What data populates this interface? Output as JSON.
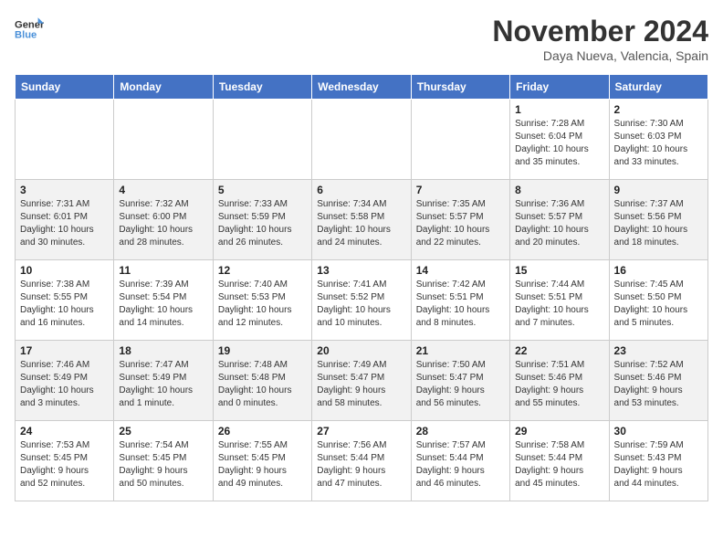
{
  "header": {
    "logo_line1": "General",
    "logo_line2": "Blue",
    "month_title": "November 2024",
    "location": "Daya Nueva, Valencia, Spain"
  },
  "weekdays": [
    "Sunday",
    "Monday",
    "Tuesday",
    "Wednesday",
    "Thursday",
    "Friday",
    "Saturday"
  ],
  "weeks": [
    [
      {
        "day": "",
        "info": ""
      },
      {
        "day": "",
        "info": ""
      },
      {
        "day": "",
        "info": ""
      },
      {
        "day": "",
        "info": ""
      },
      {
        "day": "",
        "info": ""
      },
      {
        "day": "1",
        "info": "Sunrise: 7:28 AM\nSunset: 6:04 PM\nDaylight: 10 hours\nand 35 minutes."
      },
      {
        "day": "2",
        "info": "Sunrise: 7:30 AM\nSunset: 6:03 PM\nDaylight: 10 hours\nand 33 minutes."
      }
    ],
    [
      {
        "day": "3",
        "info": "Sunrise: 7:31 AM\nSunset: 6:01 PM\nDaylight: 10 hours\nand 30 minutes."
      },
      {
        "day": "4",
        "info": "Sunrise: 7:32 AM\nSunset: 6:00 PM\nDaylight: 10 hours\nand 28 minutes."
      },
      {
        "day": "5",
        "info": "Sunrise: 7:33 AM\nSunset: 5:59 PM\nDaylight: 10 hours\nand 26 minutes."
      },
      {
        "day": "6",
        "info": "Sunrise: 7:34 AM\nSunset: 5:58 PM\nDaylight: 10 hours\nand 24 minutes."
      },
      {
        "day": "7",
        "info": "Sunrise: 7:35 AM\nSunset: 5:57 PM\nDaylight: 10 hours\nand 22 minutes."
      },
      {
        "day": "8",
        "info": "Sunrise: 7:36 AM\nSunset: 5:57 PM\nDaylight: 10 hours\nand 20 minutes."
      },
      {
        "day": "9",
        "info": "Sunrise: 7:37 AM\nSunset: 5:56 PM\nDaylight: 10 hours\nand 18 minutes."
      }
    ],
    [
      {
        "day": "10",
        "info": "Sunrise: 7:38 AM\nSunset: 5:55 PM\nDaylight: 10 hours\nand 16 minutes."
      },
      {
        "day": "11",
        "info": "Sunrise: 7:39 AM\nSunset: 5:54 PM\nDaylight: 10 hours\nand 14 minutes."
      },
      {
        "day": "12",
        "info": "Sunrise: 7:40 AM\nSunset: 5:53 PM\nDaylight: 10 hours\nand 12 minutes."
      },
      {
        "day": "13",
        "info": "Sunrise: 7:41 AM\nSunset: 5:52 PM\nDaylight: 10 hours\nand 10 minutes."
      },
      {
        "day": "14",
        "info": "Sunrise: 7:42 AM\nSunset: 5:51 PM\nDaylight: 10 hours\nand 8 minutes."
      },
      {
        "day": "15",
        "info": "Sunrise: 7:44 AM\nSunset: 5:51 PM\nDaylight: 10 hours\nand 7 minutes."
      },
      {
        "day": "16",
        "info": "Sunrise: 7:45 AM\nSunset: 5:50 PM\nDaylight: 10 hours\nand 5 minutes."
      }
    ],
    [
      {
        "day": "17",
        "info": "Sunrise: 7:46 AM\nSunset: 5:49 PM\nDaylight: 10 hours\nand 3 minutes."
      },
      {
        "day": "18",
        "info": "Sunrise: 7:47 AM\nSunset: 5:49 PM\nDaylight: 10 hours\nand 1 minute."
      },
      {
        "day": "19",
        "info": "Sunrise: 7:48 AM\nSunset: 5:48 PM\nDaylight: 10 hours\nand 0 minutes."
      },
      {
        "day": "20",
        "info": "Sunrise: 7:49 AM\nSunset: 5:47 PM\nDaylight: 9 hours\nand 58 minutes."
      },
      {
        "day": "21",
        "info": "Sunrise: 7:50 AM\nSunset: 5:47 PM\nDaylight: 9 hours\nand 56 minutes."
      },
      {
        "day": "22",
        "info": "Sunrise: 7:51 AM\nSunset: 5:46 PM\nDaylight: 9 hours\nand 55 minutes."
      },
      {
        "day": "23",
        "info": "Sunrise: 7:52 AM\nSunset: 5:46 PM\nDaylight: 9 hours\nand 53 minutes."
      }
    ],
    [
      {
        "day": "24",
        "info": "Sunrise: 7:53 AM\nSunset: 5:45 PM\nDaylight: 9 hours\nand 52 minutes."
      },
      {
        "day": "25",
        "info": "Sunrise: 7:54 AM\nSunset: 5:45 PM\nDaylight: 9 hours\nand 50 minutes."
      },
      {
        "day": "26",
        "info": "Sunrise: 7:55 AM\nSunset: 5:45 PM\nDaylight: 9 hours\nand 49 minutes."
      },
      {
        "day": "27",
        "info": "Sunrise: 7:56 AM\nSunset: 5:44 PM\nDaylight: 9 hours\nand 47 minutes."
      },
      {
        "day": "28",
        "info": "Sunrise: 7:57 AM\nSunset: 5:44 PM\nDaylight: 9 hours\nand 46 minutes."
      },
      {
        "day": "29",
        "info": "Sunrise: 7:58 AM\nSunset: 5:44 PM\nDaylight: 9 hours\nand 45 minutes."
      },
      {
        "day": "30",
        "info": "Sunrise: 7:59 AM\nSunset: 5:43 PM\nDaylight: 9 hours\nand 44 minutes."
      }
    ]
  ]
}
